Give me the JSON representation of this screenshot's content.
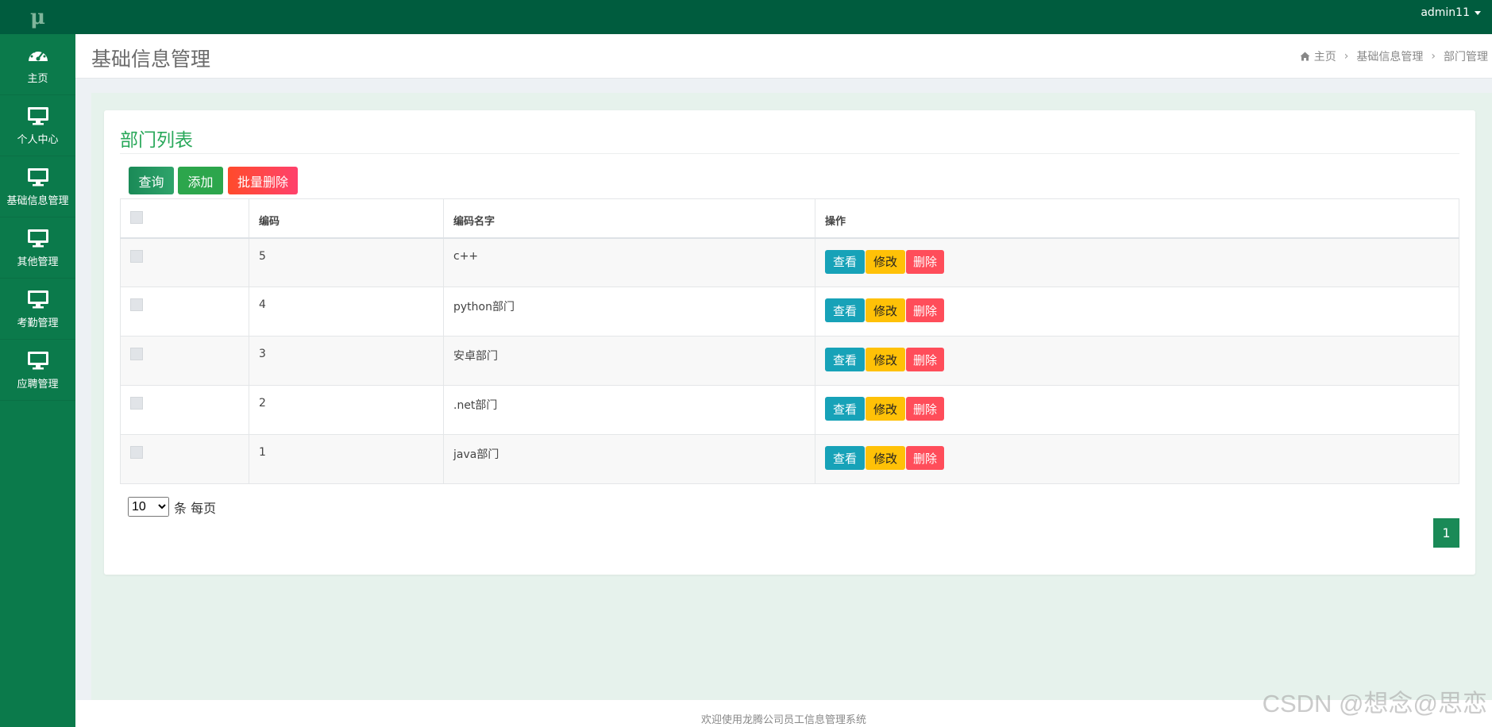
{
  "brand": {
    "logo_glyph": "μ"
  },
  "topbar": {
    "username": "admin11"
  },
  "sidebar": {
    "items": [
      {
        "label": "主页",
        "icon": "dashboard-icon"
      },
      {
        "label": "个人中心",
        "icon": "monitor-icon"
      },
      {
        "label": "基础信息管理",
        "icon": "monitor-icon"
      },
      {
        "label": "其他管理",
        "icon": "monitor-icon"
      },
      {
        "label": "考勤管理",
        "icon": "monitor-icon"
      },
      {
        "label": "应聘管理",
        "icon": "monitor-icon"
      }
    ]
  },
  "header": {
    "title": "基础信息管理",
    "breadcrumb": [
      "主页",
      "基础信息管理",
      "部门管理"
    ]
  },
  "card": {
    "title": "部门列表",
    "buttons": {
      "query": "查询",
      "add": "添加",
      "batch_delete": "批量删除"
    }
  },
  "table": {
    "columns": [
      "编码",
      "编码名字",
      "操作"
    ],
    "rows": [
      {
        "code": "5",
        "name": "c++"
      },
      {
        "code": "4",
        "name": "python部门"
      },
      {
        "code": "3",
        "name": "安卓部门"
      },
      {
        "code": "2",
        "name": ".net部门"
      },
      {
        "code": "1",
        "name": "java部门"
      }
    ],
    "actions": {
      "view": "查看",
      "edit": "修改",
      "delete": "删除"
    }
  },
  "pagination": {
    "page_size": "10",
    "page_size_suffix": "条 每页",
    "current_page": "1"
  },
  "footer": {
    "text": "欢迎使用龙腾公司员工信息管理系统"
  },
  "watermark": "CSDN @想念@思恋",
  "colors": {
    "topbar": "#005c3e",
    "sidebar": "#0b7a4b",
    "title_green": "#29a85a",
    "view": "#17a2b8",
    "edit": "#ffc107",
    "delete": "#ff4d5a"
  }
}
